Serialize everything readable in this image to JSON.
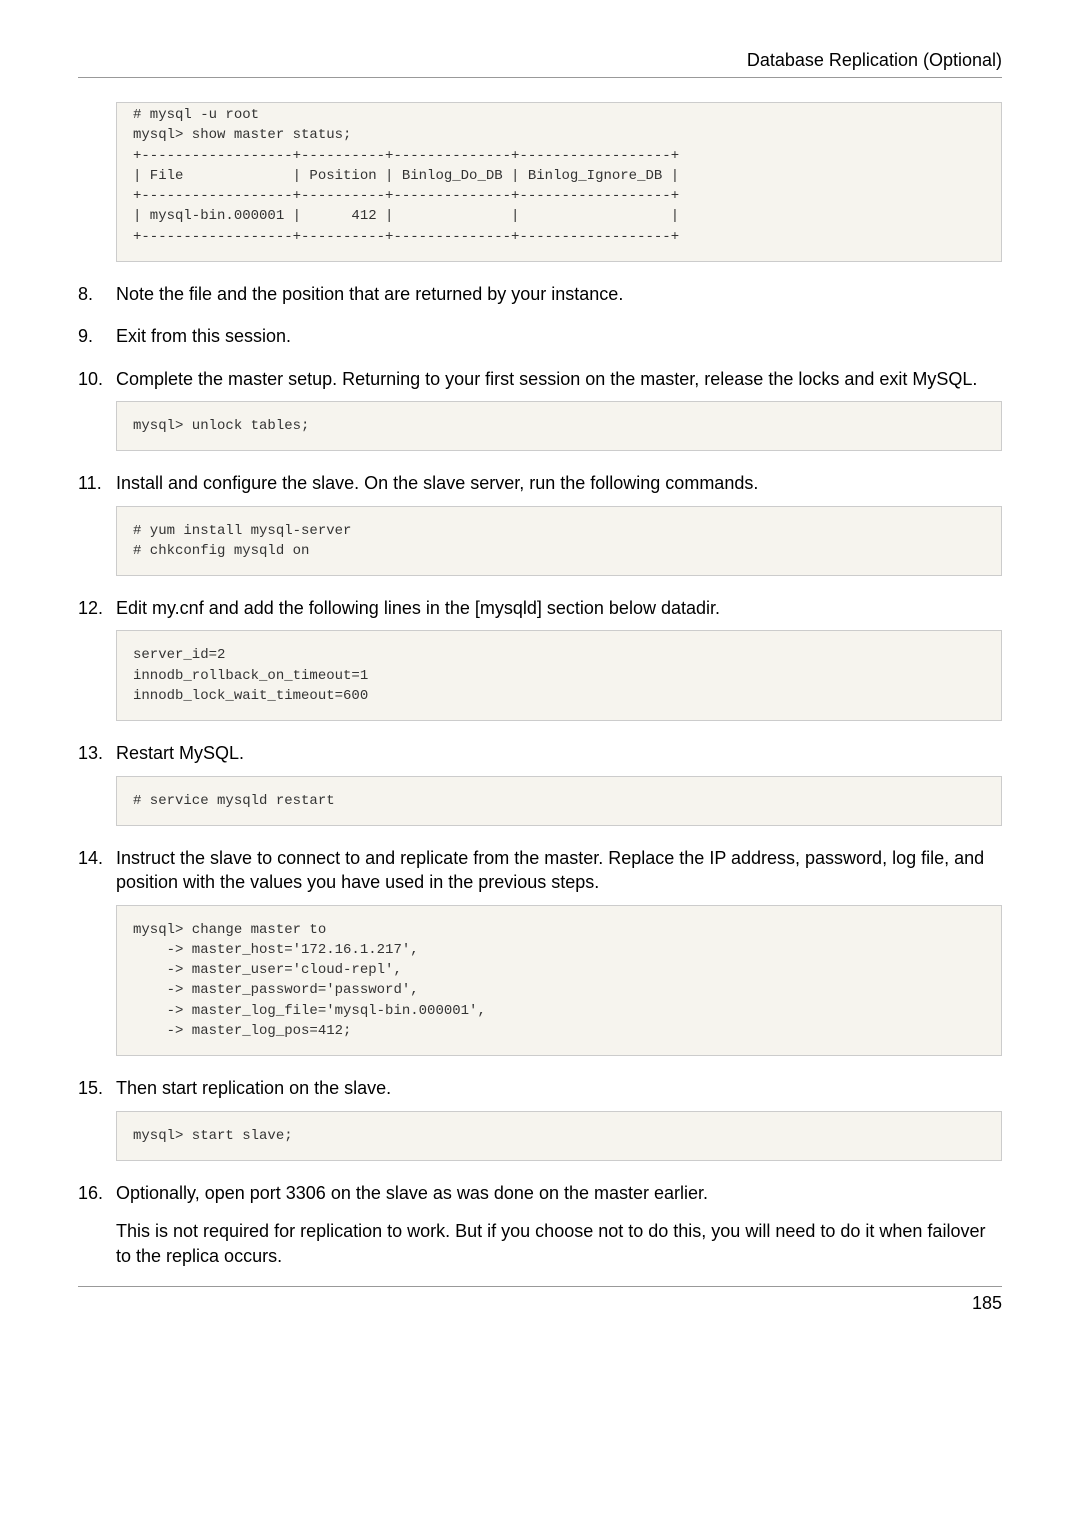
{
  "header": {
    "title": "Database Replication (Optional)"
  },
  "codeBlocks": {
    "topBlock": "# mysql -u root\nmysql> show master status;\n+------------------+----------+--------------+------------------+\n| File             | Position | Binlog_Do_DB | Binlog_Ignore_DB |\n+------------------+----------+--------------+------------------+\n| mysql-bin.000001 |      412 |              |                  |\n+------------------+----------+--------------+------------------+",
    "unlockTables": "mysql> unlock tables;",
    "installSlave": "# yum install mysql-server\n# chkconfig mysqld on",
    "myCnf": "server_id=2\ninnodb_rollback_on_timeout=1\ninnodb_lock_wait_timeout=600",
    "restart": "# service mysqld restart",
    "changeMaster": "mysql> change master to\n    -> master_host='172.16.1.217',\n    -> master_user='cloud-repl',\n    -> master_password='password',\n    -> master_log_file='mysql-bin.000001',\n    -> master_log_pos=412;",
    "startSlave": "mysql> start slave;"
  },
  "steps": {
    "s8": "Note the file and the position that are returned by your instance.",
    "s9": "Exit from this session.",
    "s10": "Complete the master setup. Returning to your first session on the master, release the locks and exit MySQL.",
    "s11": "Install and configure the slave. On the slave server, run the following commands.",
    "s12": "Edit my.cnf and add the following lines in the [mysqld] section below datadir.",
    "s13": "Restart MySQL.",
    "s14": "Instruct the slave to connect to and replicate from the master. Replace the IP address, password, log file, and position with the values you have used in the previous steps.",
    "s15": "Then start replication on the slave.",
    "s16": "Optionally, open port 3306 on the slave as was done on the master earlier.",
    "s16b": "This is not required for replication to work. But if you choose not to do this, you will need to do it when failover to the replica occurs."
  },
  "footer": {
    "pageNumber": "185"
  }
}
